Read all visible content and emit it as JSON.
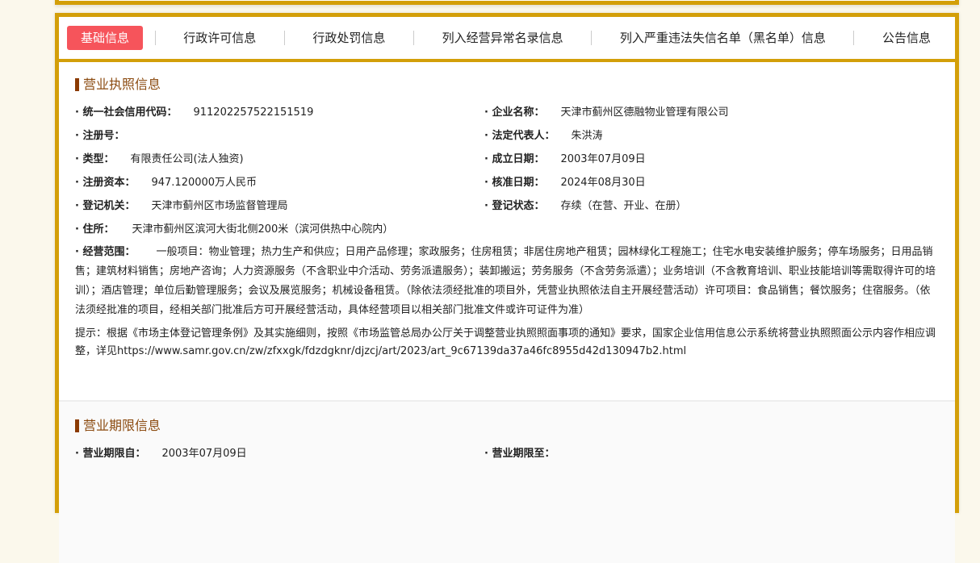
{
  "tabs": [
    "基础信息",
    "行政许可信息",
    "行政处罚信息",
    "列入经营异常名录信息",
    "列入严重违法失信名单（黑名单）信息",
    "公告信息"
  ],
  "license": {
    "title": "营业执照信息",
    "fields": [
      [
        {
          "label": "统一社会信用代码：",
          "value": "911202257522151519"
        },
        {
          "label": "企业名称：",
          "value": "天津市蓟州区德融物业管理有限公司"
        }
      ],
      [
        {
          "label": "注册号：",
          "value": ""
        },
        {
          "label": "法定代表人：",
          "value": "朱洪涛"
        }
      ],
      [
        {
          "label": "类型：",
          "value": "有限责任公司(法人独资)"
        },
        {
          "label": "成立日期：",
          "value": "2003年07月09日"
        }
      ],
      [
        {
          "label": "注册资本：",
          "value": "947.120000万人民币"
        },
        {
          "label": "核准日期：",
          "value": "2024年08月30日"
        }
      ],
      [
        {
          "label": "登记机关：",
          "value": "天津市蓟州区市场监督管理局"
        },
        {
          "label": "登记状态：",
          "value": "存续（在营、开业、在册）"
        }
      ]
    ],
    "address_label": "住所：",
    "address": "天津市蓟州区滨河大街北侧200米（滨河供热中心院内）",
    "scope_label": "经营范围：",
    "scope": "一般项目：物业管理；热力生产和供应；日用产品修理；家政服务；住房租赁；非居住房地产租赁；园林绿化工程施工；住宅水电安装维护服务；停车场服务；日用品销售；建筑材料销售；房地产咨询；人力资源服务（不含职业中介活动、劳务派遣服务）；装卸搬运；劳务服务（不含劳务派遣）；业务培训（不含教育培训、职业技能培训等需取得许可的培训）；酒店管理；单位后勤管理服务；会议及展览服务；机械设备租赁。（除依法须经批准的项目外，凭营业执照依法自主开展经营活动）许可项目：食品销售；餐饮服务；住宿服务。（依法须经批准的项目，经相关部门批准后方可开展经营活动，具体经营项目以相关部门批准文件或许可证件为准）",
    "note": "提示：根据《市场主体登记管理条例》及其实施细则，按照《市场监管总局办公厅关于调整营业执照照面事项的通知》要求，国家企业信用信息公示系统将营业执照照面公示内容作相应调整，详见https://www.samr.gov.cn/zw/zfxxgk/fdzdgknr/djzcj/art/2023/art_9c67139da37a46fc8955d42d130947b2.html"
  },
  "term": {
    "title": "营业期限信息",
    "from_label": "营业期限自：",
    "from": "2003年07月09日",
    "to_label": "营业期限至：",
    "to": ""
  }
}
